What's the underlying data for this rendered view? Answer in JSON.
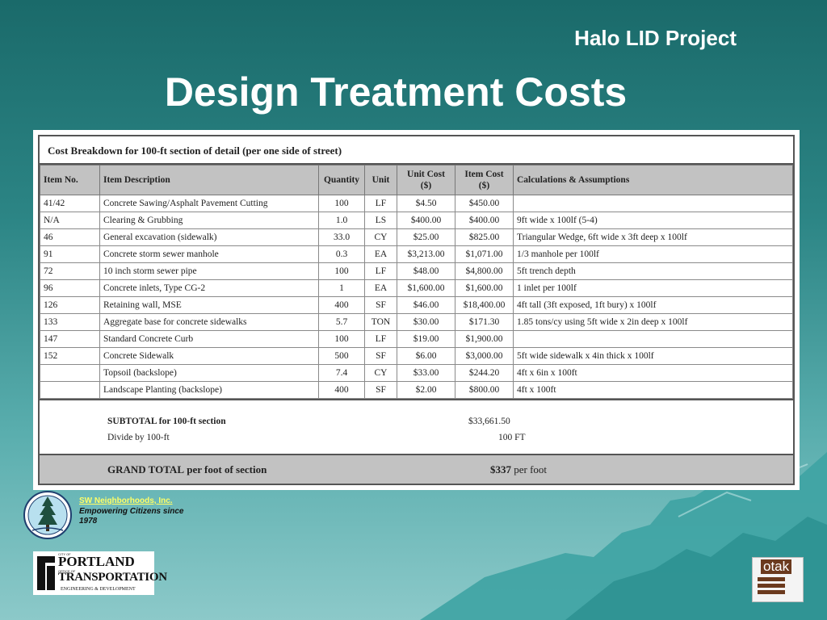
{
  "header": {
    "project_title": "Halo LID Project",
    "slide_title": "Design Treatment Costs"
  },
  "table": {
    "caption": "Cost Breakdown for 100-ft section of detail (per one side of street)",
    "columns": [
      "Item No.",
      "Item Description",
      "Quantity",
      "Unit",
      "Unit Cost ($)",
      "Item Cost ($)",
      "Calculations & Assumptions"
    ],
    "rows": [
      [
        "41/42",
        "Concrete Sawing/Asphalt Pavement Cutting",
        "100",
        "LF",
        "$4.50",
        "$450.00",
        ""
      ],
      [
        "N/A",
        "Clearing & Grubbing",
        "1.0",
        "LS",
        "$400.00",
        "$400.00",
        "9ft wide x 100lf  (5-4)"
      ],
      [
        "46",
        "General excavation (sidewalk)",
        "33.0",
        "CY",
        "$25.00",
        "$825.00",
        "Triangular Wedge, 6ft wide x 3ft deep x 100lf"
      ],
      [
        "91",
        "Concrete storm sewer manhole",
        "0.3",
        "EA",
        "$3,213.00",
        "$1,071.00",
        "1/3 manhole per 100lf"
      ],
      [
        "72",
        "10 inch storm sewer pipe",
        "100",
        "LF",
        "$48.00",
        "$4,800.00",
        "5ft trench depth"
      ],
      [
        "96",
        "Concrete inlets, Type CG-2",
        "1",
        "EA",
        "$1,600.00",
        "$1,600.00",
        "1 inlet per 100lf"
      ],
      [
        "126",
        "Retaining wall, MSE",
        "400",
        "SF",
        "$46.00",
        "$18,400.00",
        "4ft tall (3ft exposed, 1ft bury) x 100lf"
      ],
      [
        "133",
        "Aggregate base for concrete sidewalks",
        "5.7",
        "TON",
        "$30.00",
        "$171.30",
        "1.85 tons/cy using 5ft wide x 2in deep x 100lf"
      ],
      [
        "147",
        "Standard Concrete Curb",
        "100",
        "LF",
        "$19.00",
        "$1,900.00",
        ""
      ],
      [
        "152",
        "Concrete Sidewalk",
        "500",
        "SF",
        "$6.00",
        "$3,000.00",
        "5ft wide sidewalk x 4in thick x 100lf"
      ],
      [
        "",
        "Topsoil (backslope)",
        "7.4",
        "CY",
        "$33.00",
        "$244.20",
        "4ft x 6in x 100ft"
      ],
      [
        "",
        "Landscape Planting (backslope)",
        "400",
        "SF",
        "$2.00",
        "$800.00",
        "4ft x 100ft"
      ]
    ],
    "subtotal_label": "SUBTOTAL for 100-ft section",
    "subtotal_value": "$33,661.50",
    "divide_label": "Divide by 100-ft",
    "divide_value": "100 FT",
    "grand_total_prefix": "GRAND TOTAL",
    "grand_total_suffix": "per foot of section",
    "grand_total_amount": "$337",
    "grand_total_unit": "per foot"
  },
  "footer": {
    "swni_name": "SW Neighborhoods, Inc.",
    "swni_tagline": "Empowering Citizens since 1978",
    "pbot_city": "CITY OF",
    "pbot_portland": "PORTLAND",
    "pbot_office": "OFFICE OF",
    "pbot_transportation": "TRANSPORTATION",
    "pbot_engineering": "ENGINEERING & DEVELOPMENT",
    "otak": "otak"
  },
  "colors": {
    "background_top": "#1a6a6a",
    "background_bottom": "#8cc9c9",
    "header_gray": "#c2c2c2",
    "link_yellow": "#ffff66"
  }
}
